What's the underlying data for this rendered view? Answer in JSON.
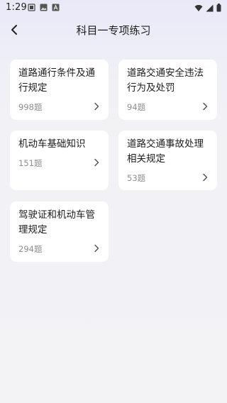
{
  "status_bar": {
    "time": "1:29",
    "left_icons": [
      "notification-icon",
      "image-icon",
      "font-icon"
    ],
    "right_icons": [
      "wifi-icon",
      "signal-icon",
      "battery-icon"
    ]
  },
  "header": {
    "title": "科目一专项练习",
    "back_icon": "chevron-left-icon"
  },
  "cards": [
    {
      "title": "道路通行条件及通行规定",
      "count": "998题"
    },
    {
      "title": "道路交通安全违法行为及处罚",
      "count": "94题"
    },
    {
      "title": "机动车基础知识",
      "count": "151题"
    },
    {
      "title": "道路交通事故处理相关规定",
      "count": "53题"
    },
    {
      "title": "驾驶证和机动车管理规定",
      "count": "294题"
    }
  ],
  "colors": {
    "card_bg": "#ffffff",
    "page_bg": "#f3f3f6",
    "header_tint": "#e9e9f8",
    "count_text": "#8e8e8e"
  }
}
